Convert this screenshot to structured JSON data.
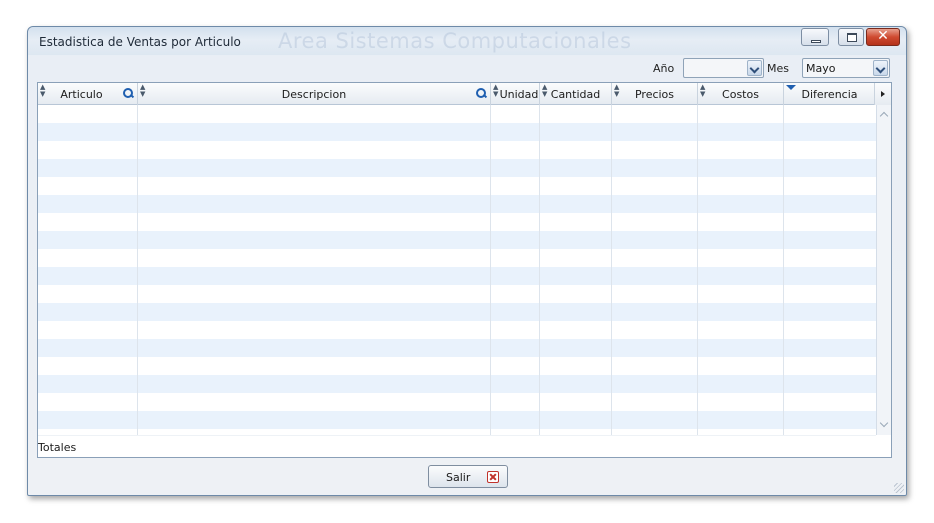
{
  "window": {
    "title": "Estadistica de Ventas por Articulo",
    "watermark": "Area Sistemas Computacionales",
    "minimize_symbol": "",
    "maximize_symbol": "",
    "close_symbol": "✕"
  },
  "filters": {
    "year_label": "Año",
    "year_value": "",
    "month_label": "Mes",
    "month_value": "Mayo"
  },
  "table": {
    "columns": [
      {
        "label": "Articulo",
        "searchable": true
      },
      {
        "label": "Descripcion",
        "searchable": true
      },
      {
        "label": "Unidad",
        "searchable": false
      },
      {
        "label": "Cantidad",
        "searchable": false
      },
      {
        "label": "Precios",
        "searchable": false
      },
      {
        "label": "Costos",
        "searchable": false
      },
      {
        "label": "Diferencia",
        "searchable": false,
        "sorted": "descending"
      }
    ],
    "rows": [],
    "totals_label": "Totales"
  },
  "footer": {
    "exit_label": "Salir"
  },
  "colors": {
    "accent": "#1f5fb0",
    "row_alt": "#e9f2fc",
    "close_button": "#cf4a30"
  }
}
